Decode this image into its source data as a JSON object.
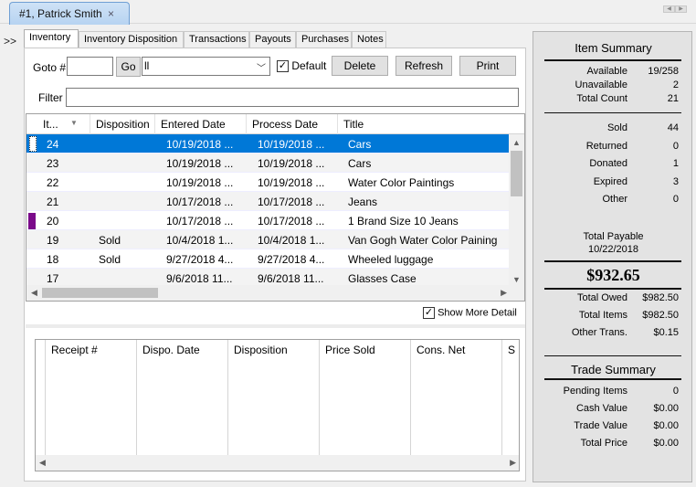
{
  "document_tab": {
    "title": "#1, Patrick Smith",
    "close": "×"
  },
  "expand_label": ">>",
  "tabs": [
    "Inventory",
    "Inventory Disposition",
    "Transactions",
    "Payouts",
    "Purchases",
    "Notes"
  ],
  "toolbar": {
    "goto_label": "Goto #",
    "goto_value": "",
    "go_label": "Go",
    "filter_select_value": "ll",
    "default_label": "Default",
    "default_checked": "✓",
    "delete_label": "Delete",
    "refresh_label": "Refresh",
    "print_label": "Print",
    "filter_label": "Filter",
    "filter_value": ""
  },
  "grid": {
    "columns": [
      "It...",
      "Disposition",
      "Entered Date",
      "Process Date",
      "Title"
    ],
    "rows": [
      {
        "item": "24",
        "disposition": "",
        "entered": "10/19/2018 ...",
        "processed": "10/19/2018 ...",
        "title": "Cars"
      },
      {
        "item": "23",
        "disposition": "",
        "entered": "10/19/2018 ...",
        "processed": "10/19/2018 ...",
        "title": "Cars"
      },
      {
        "item": "22",
        "disposition": "",
        "entered": "10/19/2018 ...",
        "processed": "10/19/2018 ...",
        "title": "Water Color Paintings"
      },
      {
        "item": "21",
        "disposition": "",
        "entered": "10/17/2018 ...",
        "processed": "10/17/2018 ...",
        "title": "Jeans"
      },
      {
        "item": "20",
        "disposition": "",
        "entered": "10/17/2018 ...",
        "processed": "10/17/2018 ...",
        "title": "1 Brand Size 10 Jeans"
      },
      {
        "item": "19",
        "disposition": "Sold",
        "entered": "10/4/2018 1...",
        "processed": "10/4/2018 1...",
        "title": "Van Gogh Water Color Paining"
      },
      {
        "item": "18",
        "disposition": "Sold",
        "entered": "9/27/2018 4...",
        "processed": "9/27/2018 4...",
        "title": "Wheeled luggage"
      },
      {
        "item": "17",
        "disposition": "",
        "entered": "9/6/2018 11...",
        "processed": "9/6/2018 11...",
        "title": "Glasses Case"
      }
    ],
    "marker_color": "#7a0a8a",
    "selected_color": "#0078d7"
  },
  "show_more": {
    "label": "Show More Detail",
    "checked": "✓"
  },
  "detail_grid": {
    "columns": [
      "Receipt #",
      "Dispo. Date",
      "Disposition",
      "Price Sold",
      "Cons. Net",
      "S"
    ]
  },
  "summary": {
    "item_title": "Item Summary",
    "stock": [
      {
        "k": "Available",
        "v": "19/258"
      },
      {
        "k": "Unavailable",
        "v": "2"
      },
      {
        "k": "Total Count",
        "v": "21"
      }
    ],
    "dispositions": [
      {
        "k": "Sold",
        "v": "44"
      },
      {
        "k": "Returned",
        "v": "0"
      },
      {
        "k": "Donated",
        "v": "1"
      },
      {
        "k": "Expired",
        "v": "3"
      },
      {
        "k": "Other",
        "v": "0"
      }
    ],
    "total_payable_label": "Total Payable",
    "total_payable_date": "10/22/2018",
    "total_payable_amount": "$932.65",
    "totals": [
      {
        "k": "Total Owed",
        "v": "$982.50"
      },
      {
        "k": "Total Items",
        "v": "$982.50"
      },
      {
        "k": "Other Trans.",
        "v": "$0.15"
      }
    ],
    "trade_title": "Trade Summary",
    "trade": [
      {
        "k": "Pending Items",
        "v": "0"
      },
      {
        "k": "Cash Value",
        "v": "$0.00"
      },
      {
        "k": "Trade Value",
        "v": "$0.00"
      },
      {
        "k": "Total Price",
        "v": "$0.00"
      }
    ]
  }
}
